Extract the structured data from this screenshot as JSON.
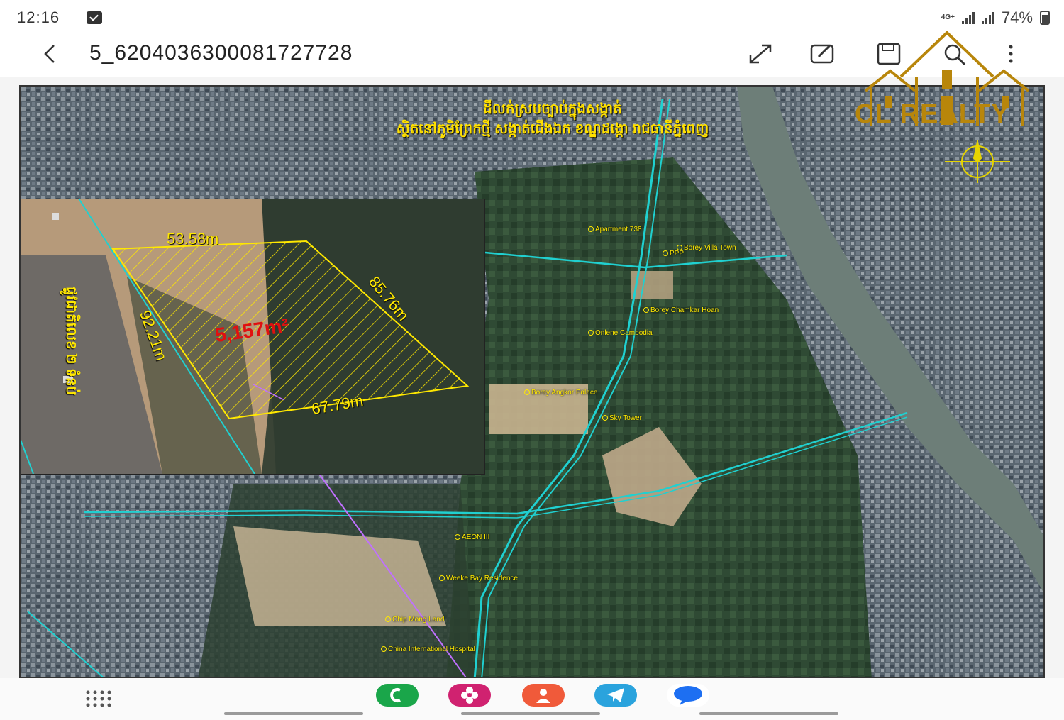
{
  "status": {
    "time": "12:16",
    "network": "4G+",
    "battery": "74%"
  },
  "header": {
    "title": "5_6204036300081727728"
  },
  "icons": {
    "back": "chevron-left-icon",
    "expand": "expand-icon",
    "edit": "edit-icon",
    "save": "save-icon",
    "search": "search-icon",
    "more": "more-vertical-icon"
  },
  "map": {
    "heading_line1": "ដីលក់ស្របច្បាប់ក្នុងសង្កាត់",
    "heading_line2": "ស្ថិតនៅភូមិព្រែកថ្មី សង្កាត់ជើងឯក ខណ្ឌដង្កោ រាជធានីភ្នំពេញ",
    "brand": "CL REALTY",
    "pois": {
      "apartment": "Apartment 738",
      "borey_villa": "Borey Villa Town",
      "ppp": "PPP",
      "borey_chamkar": "Borey Chamkar Hoan",
      "onlene": "Onlene Cambodia",
      "borey_angkor": "Borey Angkor Palace",
      "sky_tower": "Sky Tower",
      "aeon": "AEON III",
      "weeke": "Weeke Bay Residence",
      "chip_mong": "Chip Mong Land",
      "china_hospital": "China International Hospital"
    },
    "inset": {
      "top_side": "53.58m",
      "right_side": "85.76m",
      "left_side": "92.21m",
      "bottom_side": "67.79m",
      "area": "5,157m²",
      "road": "ផ្លូវជាតិលេខ ២ ទំនប់"
    },
    "colors": {
      "parcel": "#ffe800",
      "road": "#20d0d0",
      "pointer": "#c070ff",
      "area_text": "#e01010"
    }
  },
  "dock": {
    "apps": [
      "phone-app-icon",
      "blossom-app-icon",
      "contacts-app-icon",
      "telegram-app-icon",
      "messages-app-icon"
    ],
    "grid": "app-grid-icon"
  }
}
